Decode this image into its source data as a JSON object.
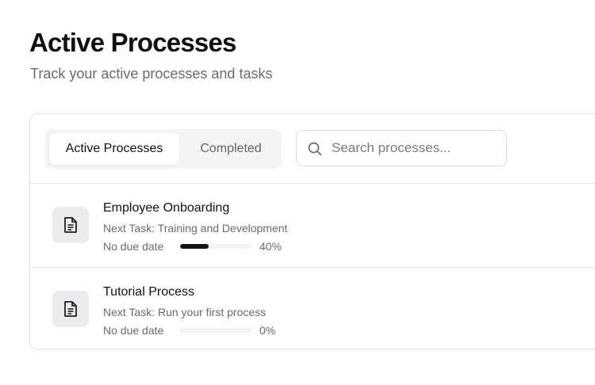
{
  "header": {
    "title": "Active Processes",
    "subtitle": "Track your active processes and tasks"
  },
  "tabs": [
    {
      "label": "Active Processes",
      "selected": true
    },
    {
      "label": "Completed",
      "selected": false
    }
  ],
  "search": {
    "placeholder": "Search processes...",
    "value": "",
    "icon": "search-icon"
  },
  "processes": [
    {
      "icon": "document-icon",
      "title": "Employee Onboarding",
      "next_task": "Next Task: Training and Development",
      "due": "No due date",
      "progress": 40,
      "progress_label": "40%"
    },
    {
      "icon": "document-icon",
      "title": "Tutorial Process",
      "next_task": "Next Task: Run your first process",
      "due": "No due date",
      "progress": 0,
      "progress_label": "0%"
    }
  ],
  "colors": {
    "accent": "#141414",
    "muted_text": "#6b6b6b",
    "tab_bg": "#f4f4f5",
    "border": "#e4e4e7"
  }
}
